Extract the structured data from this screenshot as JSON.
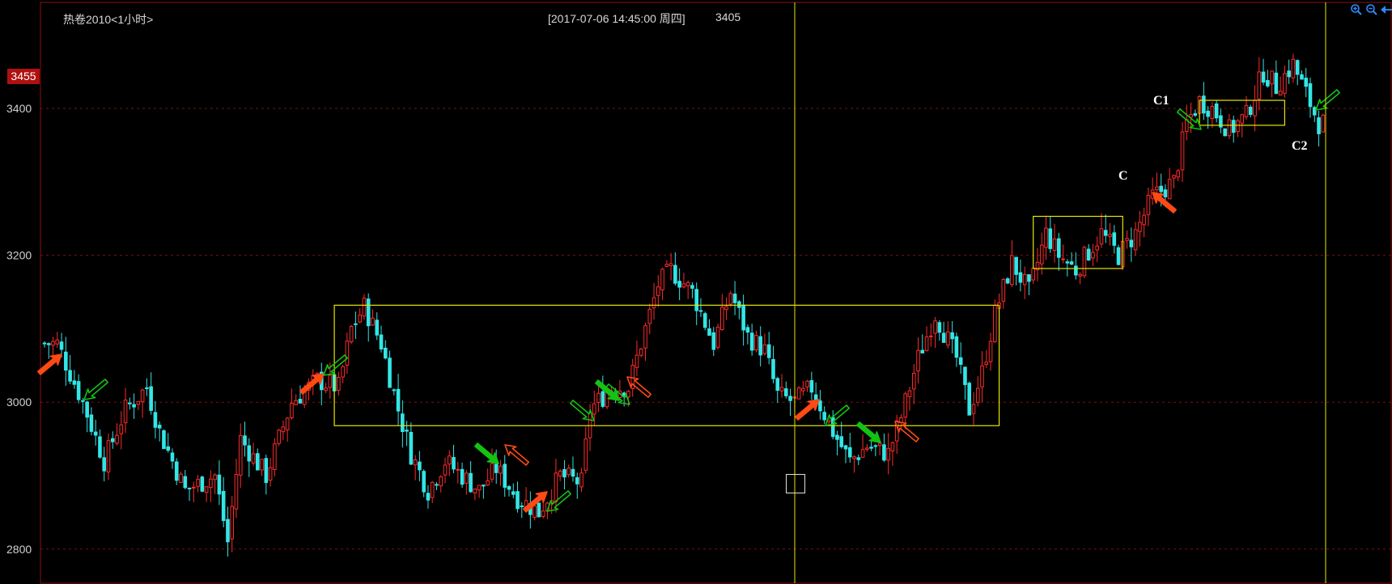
{
  "header": {
    "symbol": "热卷2010<1小时>",
    "cursor_time": "[2017-07-06  14:45:00 周四]",
    "cursor_price": "3405"
  },
  "axis": {
    "price_tag": "3455"
  },
  "toolbar": {
    "zoom_in_icon": "zoom-in-icon",
    "zoom_out_icon": "zoom-out-icon",
    "scroll_left_icon": "left-arrow-icon"
  },
  "annotations": {
    "c1": "C1",
    "c": "C",
    "c2": "C2"
  },
  "colors": {
    "up": "#ff2a2a",
    "down": "#33e6e6",
    "box": "#e6e600",
    "grid": "#7a1010",
    "border": "#8b1010",
    "crosshair": "#e6e600",
    "arrow_red": "#ff4a14",
    "arrow_green": "#13c313",
    "price_tag_bg": "#b01010"
  },
  "chart_data": {
    "type": "candlestick",
    "title": "热卷2010<1小时>",
    "yticks": [
      2800,
      3000,
      3200,
      3400
    ],
    "ylim": [
      2740,
      3500
    ],
    "xlim": [
      0,
      300
    ],
    "grid": true,
    "series": [
      {
        "x": [
          0,
          3,
          9,
          14,
          19,
          24,
          27,
          33,
          40,
          43,
          46,
          52,
          58,
          64,
          69,
          72,
          75,
          79,
          83,
          86,
          90,
          94,
          98,
          102,
          106,
          111,
          116,
          121,
          126,
          128,
          133,
          137,
          140,
          144,
          147,
          152,
          157,
          161,
          165,
          169,
          172,
          176,
          180,
          185,
          189,
          193,
          198,
          201,
          205,
          209,
          214,
          217,
          220,
          223,
          227,
          231,
          235,
          238,
          242,
          248,
          252,
          256,
          260,
          265,
          268,
          271,
          274,
          278,
          282,
          286,
          289,
          293,
          296,
          299
        ],
        "close": [
          3080,
          3080,
          3000,
          2920,
          2990,
          3020,
          2960,
          2880,
          2900,
          2810,
          2950,
          2900,
          3000,
          3030,
          3020,
          3100,
          3130,
          3080,
          2990,
          2930,
          2880,
          2920,
          2900,
          2880,
          2910,
          2870,
          2850,
          2900,
          2890,
          2990,
          3020,
          3020,
          3080,
          3160,
          3180,
          3150,
          3080,
          3150,
          3090,
          3070,
          3010,
          3000,
          3020,
          2960,
          2920,
          2940,
          2930,
          2980,
          3060,
          3120,
          3060,
          2990,
          3040,
          3120,
          3190,
          3150,
          3230,
          3200,
          3180,
          3230,
          3200,
          3230,
          3280,
          3300,
          3380,
          3410,
          3400,
          3370,
          3390,
          3450,
          3430,
          3460,
          3420,
          3380
        ]
      }
    ]
  }
}
